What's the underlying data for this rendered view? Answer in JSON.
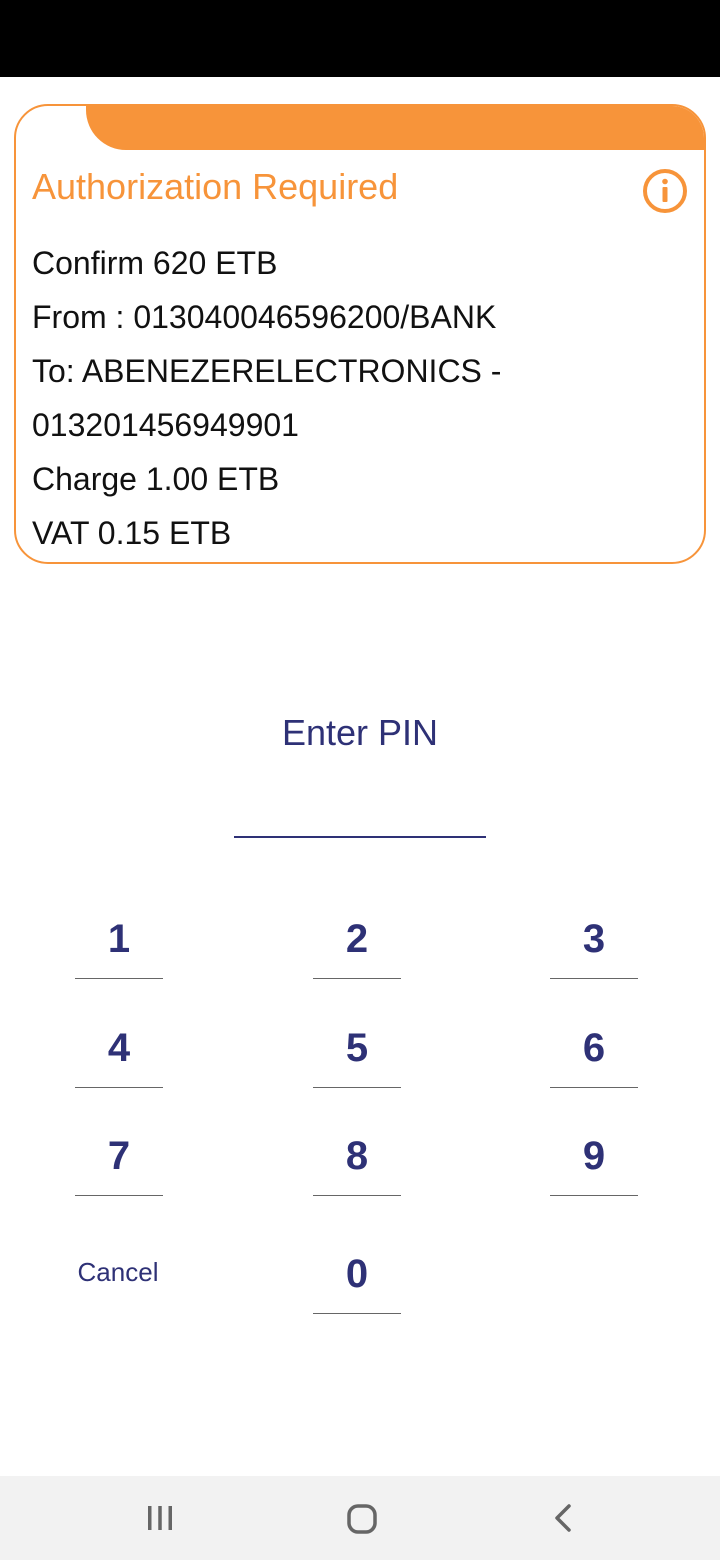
{
  "card": {
    "title": "Authorization Required",
    "lines": [
      "Confirm  620 ETB",
      "From : 013040046596200/BANK",
      "To: ABENEZERELECTRONICS -",
      "013201456949901",
      "Charge 1.00 ETB",
      "VAT 0.15 ETB"
    ],
    "icon": "info-icon"
  },
  "pin": {
    "title": "Enter PIN",
    "value": ""
  },
  "keypad": {
    "keys": [
      "1",
      "2",
      "3",
      "4",
      "5",
      "6",
      "7",
      "8",
      "9",
      "0"
    ],
    "cancel_label": "Cancel"
  },
  "nav": {
    "icons": [
      "recents-icon",
      "home-icon",
      "back-icon"
    ]
  },
  "colors": {
    "accent": "#f7943a",
    "primary": "#2e3176",
    "status_bar": "#000000",
    "nav_bar": "#f2f2f2"
  }
}
